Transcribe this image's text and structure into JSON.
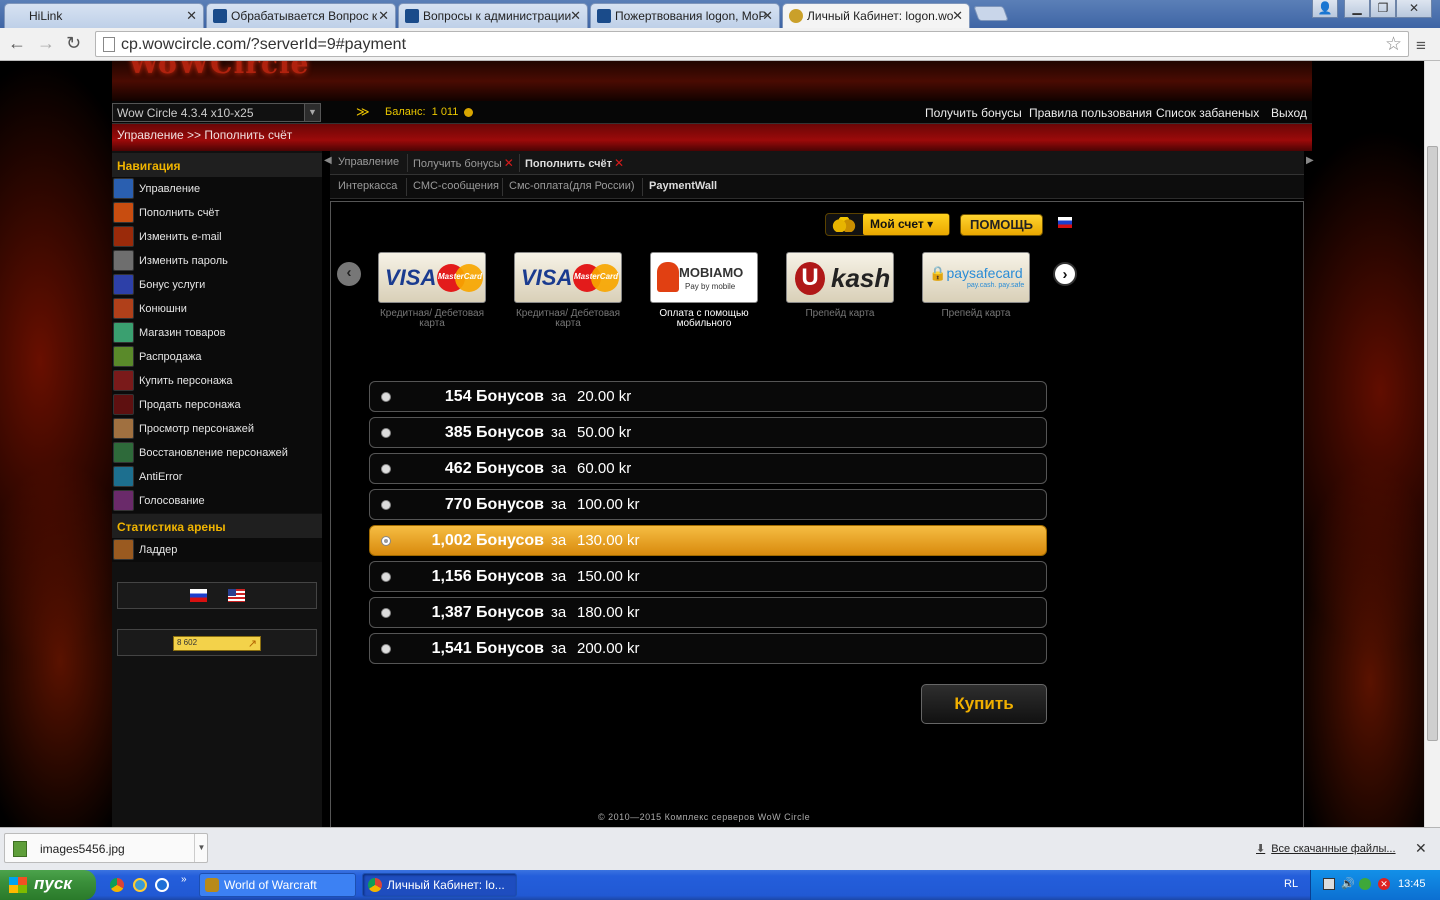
{
  "browser": {
    "tabs": [
      {
        "label": "HiLink",
        "active": false
      },
      {
        "label": "Обрабатывается Вопрос к",
        "active": false
      },
      {
        "label": "Вопросы к администрации",
        "active": false
      },
      {
        "label": "Пожертвования logon, MoP",
        "active": false
      },
      {
        "label": "Личный Кабинет: logon.wo",
        "active": true
      }
    ],
    "url": "cp.wowcircle.com/?serverId=9#payment"
  },
  "site": {
    "logo": "WoWCircle",
    "realm": "Wow Circle 4.3.4 x10-x25",
    "balance_label": "Баланс:",
    "balance_value": "1 011",
    "top_links": [
      "Получить бонусы",
      "Правила пользования",
      "Список забаненых",
      "Выход"
    ],
    "breadcrumb": "Управление >> Пополнить счёт"
  },
  "sidebar": {
    "nav_title": "Навигация",
    "nav_items": [
      {
        "label": "Управление",
        "icon": "management-icon",
        "color": "#2a5fb0"
      },
      {
        "label": "Пополнить счёт",
        "icon": "top-up-icon",
        "color": "#c84d10"
      },
      {
        "label": "Изменить e-mail",
        "icon": "email-icon",
        "color": "#9a2a0a"
      },
      {
        "label": "Изменить пароль",
        "icon": "password-icon",
        "color": "#6e6e6e"
      },
      {
        "label": "Бонус услуги",
        "icon": "bonus-services-icon",
        "color": "#2d40a8"
      },
      {
        "label": "Конюшни",
        "icon": "stables-icon",
        "color": "#b0401a"
      },
      {
        "label": "Магазин товаров",
        "icon": "shop-icon",
        "color": "#3aa070"
      },
      {
        "label": "Распродажа",
        "icon": "sale-icon",
        "color": "#5a8a2a"
      },
      {
        "label": "Купить персонажа",
        "icon": "buy-character-icon",
        "color": "#7a1a1a"
      },
      {
        "label": "Продать персонажа",
        "icon": "sell-character-icon",
        "color": "#5e1010"
      },
      {
        "label": "Просмотр персонажей",
        "icon": "view-characters-icon",
        "color": "#a07040"
      },
      {
        "label": "Восстановление персонажей",
        "icon": "restore-characters-icon",
        "color": "#2e6a3a"
      },
      {
        "label": "AntiError",
        "icon": "antierror-icon",
        "color": "#1d6f8f"
      },
      {
        "label": "Голосование",
        "icon": "voting-icon",
        "color": "#6a2a6a"
      }
    ],
    "arena_title": "Статистика арены",
    "arena_items": [
      {
        "label": "Ладдер",
        "icon": "ladder-icon",
        "color": "#9a5a20"
      }
    ],
    "counter_text": "8 602"
  },
  "content": {
    "tabs_row1": [
      {
        "label": "Управление",
        "closable": false,
        "current": false
      },
      {
        "label": "Получить бонусы",
        "closable": true,
        "current": false
      },
      {
        "label": "Пополнить счёт",
        "closable": true,
        "current": true
      }
    ],
    "tabs_row2": [
      {
        "label": "Интеркасса",
        "current": false
      },
      {
        "label": "СМС-сообщения",
        "current": false
      },
      {
        "label": "Смс-оплата(для России)",
        "current": false
      },
      {
        "label": "PaymentWall",
        "current": true
      }
    ]
  },
  "paymentwall": {
    "my_account": "Мой счет",
    "help": "ПОМОЩЬ",
    "methods": [
      {
        "brand": "VISA",
        "brand2": "MasterCard",
        "caption": "Кредитная/ Дебетовая карта",
        "selected": false
      },
      {
        "brand": "VISA",
        "brand2": "MasterCard",
        "caption": "Кредитная/ Дебетовая карта",
        "selected": false
      },
      {
        "brand": "MOBIAMO",
        "brand2": "Pay by mobile",
        "caption": "Оплата с помощью мобильного",
        "selected": true
      },
      {
        "brand": "U",
        "brand2": "kash",
        "caption": "Препейд карта",
        "selected": false
      },
      {
        "brand": "paysafecard",
        "brand2": "pay.cash. pay.safe",
        "caption": "Препейд карта",
        "selected": false
      }
    ],
    "options": [
      {
        "amount": "154 Бонусов",
        "price": "20.00 kr",
        "selected": false
      },
      {
        "amount": "385 Бонусов",
        "price": "50.00 kr",
        "selected": false
      },
      {
        "amount": "462 Бонусов",
        "price": "60.00 kr",
        "selected": false
      },
      {
        "amount": "770 Бонусов",
        "price": "100.00 kr",
        "selected": false
      },
      {
        "amount": "1,002 Бонусов",
        "price": "130.00 kr",
        "selected": true
      },
      {
        "amount": "1,156 Бонусов",
        "price": "150.00 kr",
        "selected": false
      },
      {
        "amount": "1,387 Бонусов",
        "price": "180.00 kr",
        "selected": false
      },
      {
        "amount": "1,541 Бонусов",
        "price": "200.00 kr",
        "selected": false
      }
    ],
    "price_prefix": "за",
    "buy": "Купить"
  },
  "footer": "© 2010—2015 Комплекс серверов WoW Circle",
  "downloads": {
    "file": "images5456.jpg",
    "all_files": "Все скачанные файлы..."
  },
  "taskbar": {
    "start": "пуск",
    "windows": [
      "World of Warcraft",
      "Личный Кабинет: lo..."
    ],
    "lang": "RL",
    "clock": "13:45"
  }
}
